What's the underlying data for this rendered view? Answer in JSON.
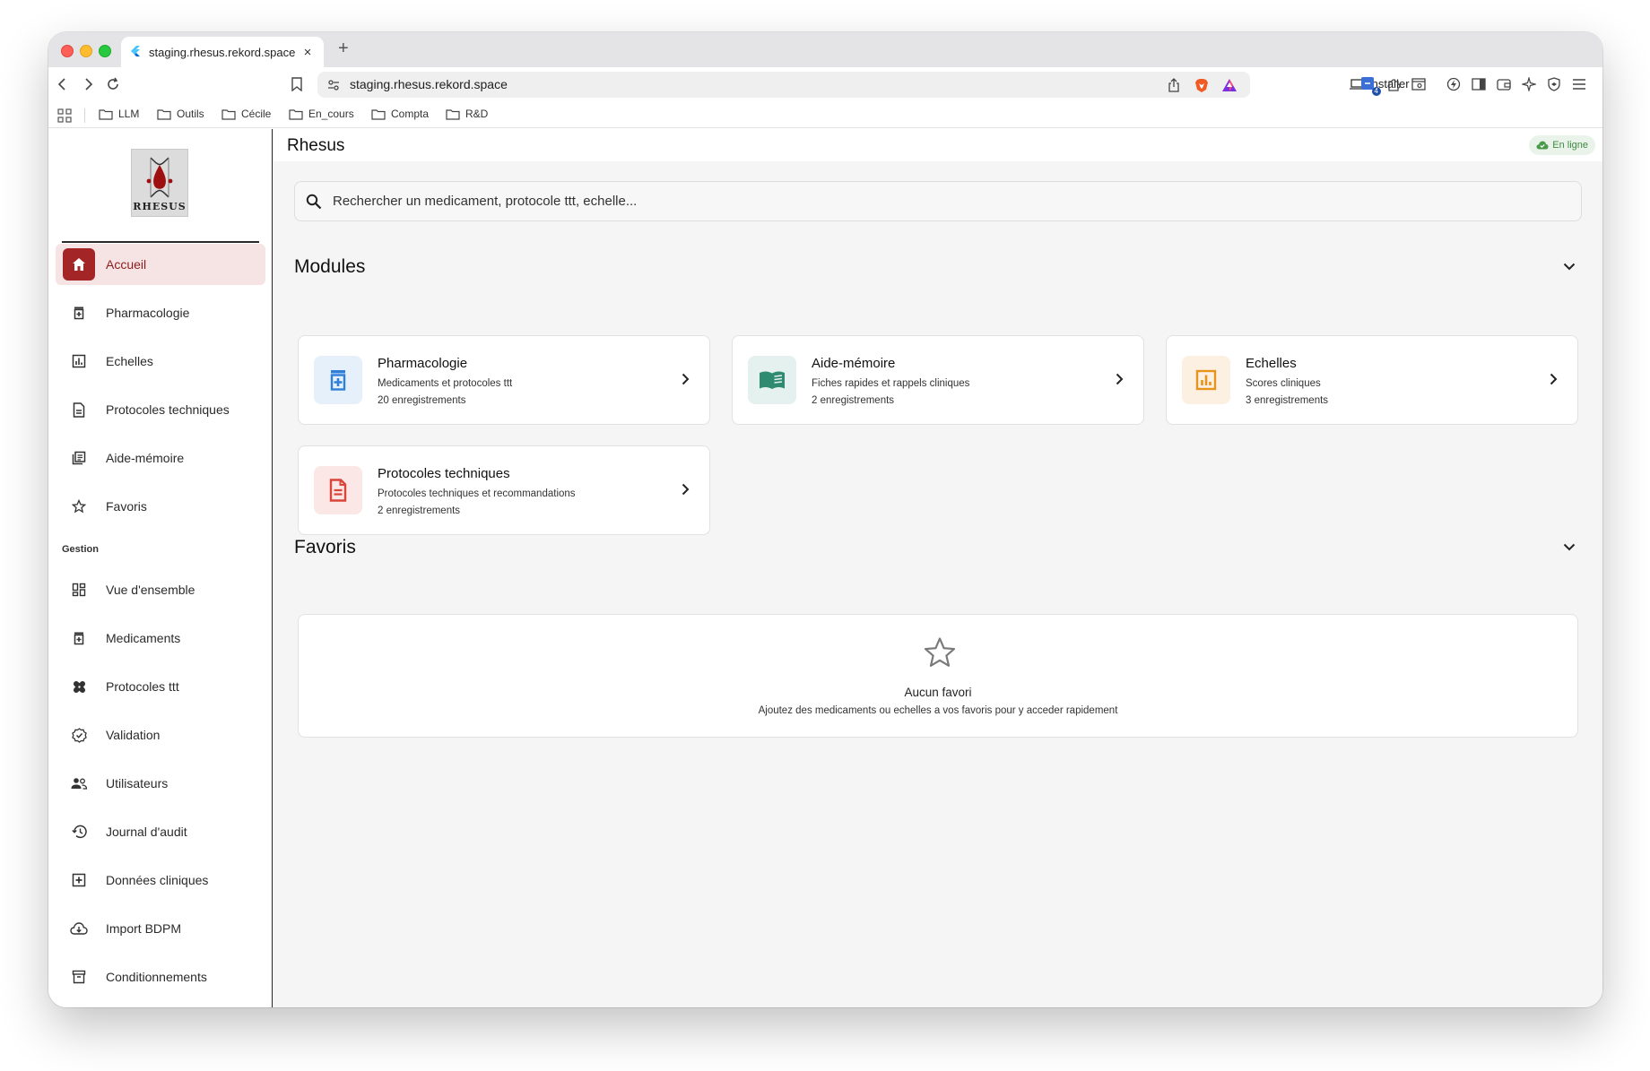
{
  "browser": {
    "tab_title": "staging.rhesus.rekord.space",
    "tab_close": "×",
    "new_tab": "+",
    "url": "staging.rhesus.rekord.space",
    "install_label": "Installer",
    "extension_badge": "4",
    "bookmarks": [
      "LLM",
      "Outils",
      "Cécile",
      "En_cours",
      "Compta",
      "R&D"
    ]
  },
  "app": {
    "title": "Rhesus",
    "logo_text": "RHESUS",
    "status": "En ligne",
    "accent_color": "#a32525",
    "nav_main": [
      {
        "label": "Accueil",
        "icon": "home-icon",
        "active": true
      },
      {
        "label": "Pharmacologie",
        "icon": "medication-icon"
      },
      {
        "label": "Echelles",
        "icon": "bar-chart-icon"
      },
      {
        "label": "Protocoles techniques",
        "icon": "document-icon"
      },
      {
        "label": "Aide-mémoire",
        "icon": "notes-icon"
      },
      {
        "label": "Favoris",
        "icon": "star-icon"
      }
    ],
    "nav_section_label": "Gestion",
    "nav_gestion": [
      {
        "label": "Vue d'ensemble",
        "icon": "dashboard-icon"
      },
      {
        "label": "Medicaments",
        "icon": "medication-icon"
      },
      {
        "label": "Protocoles ttt",
        "icon": "bandage-icon"
      },
      {
        "label": "Validation",
        "icon": "verified-icon"
      },
      {
        "label": "Utilisateurs",
        "icon": "users-icon"
      },
      {
        "label": "Journal d'audit",
        "icon": "history-icon"
      },
      {
        "label": "Données cliniques",
        "icon": "add-box-icon"
      },
      {
        "label": "Import BDPM",
        "icon": "cloud-download-icon"
      },
      {
        "label": "Conditionnements",
        "icon": "archive-icon"
      }
    ]
  },
  "search": {
    "placeholder": "Rechercher un medicament, protocole ttt, echelle...",
    "value": ""
  },
  "modules": {
    "title": "Modules",
    "cards": [
      {
        "title": "Pharmacologie",
        "desc": "Medicaments et protocoles ttt",
        "count": "20 enregistrements",
        "icon": "medication-icon",
        "color": "#2f7fd8",
        "bg": "#e6f0fb"
      },
      {
        "title": "Aide-mémoire",
        "desc": "Fiches rapides et rappels cliniques",
        "count": "2 enregistrements",
        "icon": "book-icon",
        "color": "#2e8b70",
        "bg": "#e4f1ee"
      },
      {
        "title": "Echelles",
        "desc": "Scores cliniques",
        "count": "3 enregistrements",
        "icon": "bar-chart-icon",
        "color": "#e8931d",
        "bg": "#fcf0e2"
      },
      {
        "title": "Protocoles techniques",
        "desc": "Protocoles techniques et recommandations",
        "count": "2 enregistrements",
        "icon": "document-icon",
        "color": "#d9453a",
        "bg": "#fbe7e5"
      }
    ]
  },
  "favorites": {
    "title": "Favoris",
    "empty_title": "Aucun favori",
    "empty_subtitle": "Ajoutez des medicaments ou echelles a vos favoris pour y acceder rapidement"
  }
}
